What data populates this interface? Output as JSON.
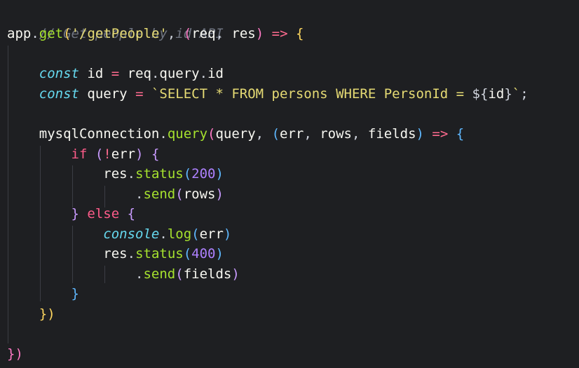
{
  "code": {
    "line1": "// Get people by id API",
    "line2": {
      "app": "app",
      "dot": ".",
      "get": "get",
      "open_paren": "(",
      "string": "'/getPeople'",
      "comma": ", ",
      "params_open": "(",
      "req": "req",
      "comma2": ", ",
      "res": "res",
      "params_close": ")",
      "arrow": " => ",
      "brace_open": "{"
    },
    "line4": {
      "indent": "    ",
      "const": "const",
      "space": " ",
      "id": "id",
      "assign": " = ",
      "req": "req",
      "dot1": ".",
      "query": "query",
      "dot2": ".",
      "id2": "id"
    },
    "line5": {
      "indent": "    ",
      "const": "const",
      "space": " ",
      "query": "query",
      "assign": " = ",
      "tick_open": "`",
      "sql": "SELECT * FROM persons WHERE PersonId = ",
      "interp_open": "${",
      "interp_id": "id",
      "interp_close": "}",
      "tick_close": "`",
      "semi": ";"
    },
    "line7": {
      "indent": "    ",
      "obj": "mysqlConnection",
      "dot": ".",
      "method": "query",
      "open_paren": "(",
      "arg": "query",
      "comma": ", ",
      "params_open": "(",
      "err": "err",
      "comma2": ", ",
      "rows": "rows",
      "comma3": ", ",
      "fields": "fields",
      "params_close": ")",
      "arrow": " => ",
      "brace_open": "{"
    },
    "line8": {
      "indent": "        ",
      "if": "if",
      "space": " ",
      "open_paren": "(",
      "not": "!",
      "err": "err",
      "close_paren": ")",
      "space2": " ",
      "brace_open": "{"
    },
    "line9": {
      "indent": "            ",
      "res": "res",
      "dot": ".",
      "method": "status",
      "open_paren": "(",
      "num": "200",
      "close_paren": ")"
    },
    "line10": {
      "indent": "                ",
      "dot": ".",
      "method": "send",
      "open_paren": "(",
      "arg": "rows",
      "close_paren": ")"
    },
    "line11": {
      "indent": "        ",
      "brace_close": "}",
      "else": " else ",
      "brace_open": "{"
    },
    "line12": {
      "indent": "            ",
      "console": "console",
      "dot": ".",
      "method": "log",
      "open_paren": "(",
      "arg": "err",
      "close_paren": ")"
    },
    "line13": {
      "indent": "            ",
      "res": "res",
      "dot": ".",
      "method": "status",
      "open_paren": "(",
      "num": "400",
      "close_paren": ")"
    },
    "line14": {
      "indent": "                ",
      "dot": ".",
      "method": "send",
      "open_paren": "(",
      "arg": "fields",
      "close_paren": ")"
    },
    "line15": {
      "indent": "        ",
      "brace_close": "}"
    },
    "line16": {
      "indent": "    ",
      "brace_close": "}",
      "paren_close": ")"
    },
    "line18": {
      "brace_close": "}",
      "paren_close": ")"
    }
  },
  "colors": {
    "background": "#1e1f22",
    "comment": "#6f7480",
    "keyword": "#ff5c8a",
    "storage": "#66d9ef",
    "function": "#a6e22e",
    "string": "#e6db74",
    "number": "#ae81ff",
    "text": "#f8f8f2"
  }
}
